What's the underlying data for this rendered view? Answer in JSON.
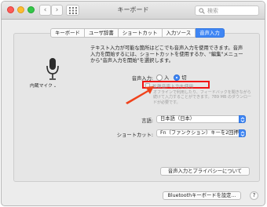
{
  "window": {
    "title": "キーボード"
  },
  "search": {
    "placeholder": "検索"
  },
  "tabs": [
    {
      "label": "キーボード"
    },
    {
      "label": "ユーザ辞書"
    },
    {
      "label": "ショートカット"
    },
    {
      "label": "入力ソース"
    },
    {
      "label": "音声入力"
    }
  ],
  "active_tab": "音声入力",
  "mic": {
    "label": "内蔵マイク",
    "chevron": "⌄"
  },
  "description": "テキスト入力が可能な箇所はどこでも音声入力を使用できます。音声入力を開始するには、ショートカットを使用するか、\"編集\"メニューから\"音声入力を開始\"を選択します。",
  "dictation": {
    "label": "音声入力:",
    "options": [
      {
        "label": "入",
        "selected": false
      },
      {
        "label": "切",
        "selected": true
      }
    ]
  },
  "enhanced": {
    "label": "拡張音声入力を使用",
    "checked": false,
    "note": "オフラインで利用したり、フィードバックを聞きながら続けて入力することができます。789 MB のダウンロードが必要です。"
  },
  "language": {
    "label": "言語:",
    "value": "日本語（日本）"
  },
  "shortcut": {
    "label": "ショートカット:",
    "value": "Fn（ファンクション）キーを2回押す"
  },
  "buttons": {
    "privacy": "音声入力とプライバシーについて",
    "bluetooth": "Bluetoothキーボードを設定...",
    "help": "?"
  },
  "colors": {
    "accent": "#3f86f4",
    "highlight": "#f11515",
    "arrow": "#f0421b"
  }
}
